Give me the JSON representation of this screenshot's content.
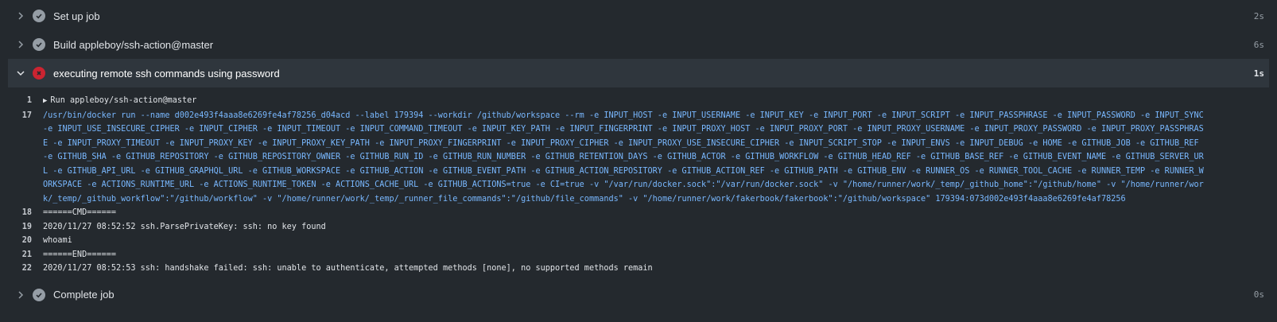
{
  "steps": {
    "setup": {
      "title": "Set up job",
      "duration": "2s"
    },
    "build": {
      "title": "Build appleboy/ssh-action@master",
      "duration": "6s"
    },
    "exec": {
      "title": "executing remote ssh commands using password",
      "duration": "1s"
    },
    "complete": {
      "title": "Complete job",
      "duration": "0s"
    }
  },
  "log": {
    "lines": [
      {
        "n": "1",
        "text": "Run appleboy/ssh-action@master"
      },
      {
        "n": "17",
        "text": "/usr/bin/docker run --name d002e493f4aaa8e6269fe4af78256_d04acd --label 179394 --workdir /github/workspace --rm -e INPUT_HOST -e INPUT_USERNAME -e INPUT_KEY -e INPUT_PORT -e INPUT_SCRIPT -e INPUT_PASSPHRASE -e INPUT_PASSWORD -e INPUT_SYNC -e INPUT_USE_INSECURE_CIPHER -e INPUT_CIPHER -e INPUT_TIMEOUT -e INPUT_COMMAND_TIMEOUT -e INPUT_KEY_PATH -e INPUT_FINGERPRINT -e INPUT_PROXY_HOST -e INPUT_PROXY_PORT -e INPUT_PROXY_USERNAME -e INPUT_PROXY_PASSWORD -e INPUT_PROXY_PASSPHRASE -e INPUT_PROXY_TIMEOUT -e INPUT_PROXY_KEY -e INPUT_PROXY_KEY_PATH -e INPUT_PROXY_FINGERPRINT -e INPUT_PROXY_CIPHER -e INPUT_PROXY_USE_INSECURE_CIPHER -e INPUT_SCRIPT_STOP -e INPUT_ENVS -e INPUT_DEBUG -e HOME -e GITHUB_JOB -e GITHUB_REF -e GITHUB_SHA -e GITHUB_REPOSITORY -e GITHUB_REPOSITORY_OWNER -e GITHUB_RUN_ID -e GITHUB_RUN_NUMBER -e GITHUB_RETENTION_DAYS -e GITHUB_ACTOR -e GITHUB_WORKFLOW -e GITHUB_HEAD_REF -e GITHUB_BASE_REF -e GITHUB_EVENT_NAME -e GITHUB_SERVER_URL -e GITHUB_API_URL -e GITHUB_GRAPHQL_URL -e GITHUB_WORKSPACE -e GITHUB_ACTION -e GITHUB_EVENT_PATH -e GITHUB_ACTION_REPOSITORY -e GITHUB_ACTION_REF -e GITHUB_PATH -e GITHUB_ENV -e RUNNER_OS -e RUNNER_TOOL_CACHE -e RUNNER_TEMP -e RUNNER_WORKSPACE -e ACTIONS_RUNTIME_URL -e ACTIONS_RUNTIME_TOKEN -e ACTIONS_CACHE_URL -e GITHUB_ACTIONS=true -e CI=true -v \"/var/run/docker.sock\":\"/var/run/docker.sock\" -v \"/home/runner/work/_temp/_github_home\":\"/github/home\" -v \"/home/runner/work/_temp/_github_workflow\":\"/github/workflow\" -v \"/home/runner/work/_temp/_runner_file_commands\":\"/github/file_commands\" -v \"/home/runner/work/fakerbook/fakerbook\":\"/github/workspace\" 179394:073d002e493f4aaa8e6269fe4af78256"
      },
      {
        "n": "18",
        "text": "======CMD======"
      },
      {
        "n": "19",
        "text": "2020/11/27 08:52:52 ssh.ParsePrivateKey: ssh: no key found"
      },
      {
        "n": "20",
        "text": "whoami"
      },
      {
        "n": "21",
        "text": "======END======"
      },
      {
        "n": "22",
        "text": "2020/11/27 08:52:53 ssh: handshake failed: ssh: unable to authenticate, attempted methods [none], no supported methods remain"
      }
    ]
  },
  "icons": {
    "collapsed": "chevron-right-icon",
    "expanded": "chevron-down-icon",
    "success": "check-circle-icon",
    "failure": "x-circle-icon",
    "group": "triangle-right-icon"
  },
  "colors": {
    "background": "#24292e",
    "active_row": "#2f363d",
    "command_text": "#79b8ff",
    "failure": "#cb2431",
    "success": "#959da5"
  }
}
